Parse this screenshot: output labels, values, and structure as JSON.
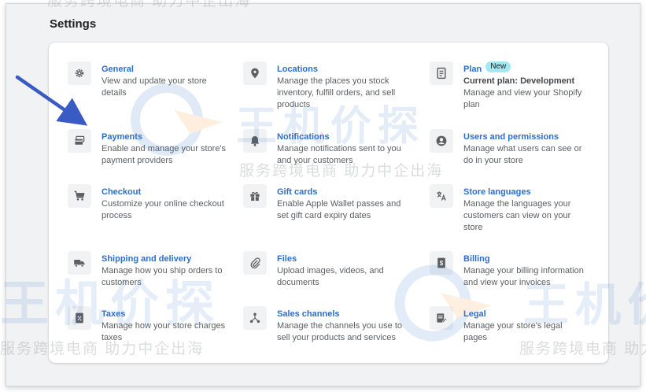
{
  "page": {
    "title": "Settings"
  },
  "items": [
    {
      "id": "general",
      "title": "General",
      "desc": "View and update your store details",
      "icon": "gear-icon"
    },
    {
      "id": "locations",
      "title": "Locations",
      "desc": "Manage the places you stock inventory, fulfill orders, and sell products",
      "icon": "location-pin-icon"
    },
    {
      "id": "plan",
      "title": "Plan",
      "badge": "New",
      "subtitle": "Current plan: Development",
      "desc": "Manage and view your Shopify plan",
      "icon": "document-icon"
    },
    {
      "id": "payments",
      "title": "Payments",
      "desc": "Enable and manage your store's payment providers",
      "icon": "payment-card-icon"
    },
    {
      "id": "notifications",
      "title": "Notifications",
      "desc": "Manage notifications sent to you and your customers",
      "icon": "bell-icon"
    },
    {
      "id": "users",
      "title": "Users and permissions",
      "desc": "Manage what users can see or do in your store",
      "icon": "user-icon"
    },
    {
      "id": "checkout",
      "title": "Checkout",
      "desc": "Customize your online checkout process",
      "icon": "cart-icon"
    },
    {
      "id": "giftcards",
      "title": "Gift cards",
      "desc": "Enable Apple Wallet passes and set gift card expiry dates",
      "icon": "gift-icon"
    },
    {
      "id": "languages",
      "title": "Store languages",
      "desc": "Manage the languages your customers can view on your store",
      "icon": "translate-icon"
    },
    {
      "id": "shipping",
      "title": "Shipping and delivery",
      "desc": "Manage how you ship orders to customers",
      "icon": "truck-icon"
    },
    {
      "id": "files",
      "title": "Files",
      "desc": "Upload images, videos, and documents",
      "icon": "paperclip-icon"
    },
    {
      "id": "billing",
      "title": "Billing",
      "desc": "Manage your billing information and view your invoices",
      "icon": "billing-icon"
    },
    {
      "id": "taxes",
      "title": "Taxes",
      "desc": "Manage how your store charges taxes",
      "icon": "tax-icon"
    },
    {
      "id": "saleschannels",
      "title": "Sales channels",
      "desc": "Manage the channels you use to sell your products and services",
      "icon": "channels-icon"
    },
    {
      "id": "legal",
      "title": "Legal",
      "desc": "Manage your store's legal pages",
      "icon": "legal-icon"
    }
  ],
  "watermark": {
    "text": "服务跨境电商 助力中企出海",
    "brand": "王机价探"
  },
  "colors": {
    "link": "#2c6ecb",
    "badge": "#a4e8f2",
    "icon": "#5c5f62",
    "arrow": "#3b5bc4"
  }
}
